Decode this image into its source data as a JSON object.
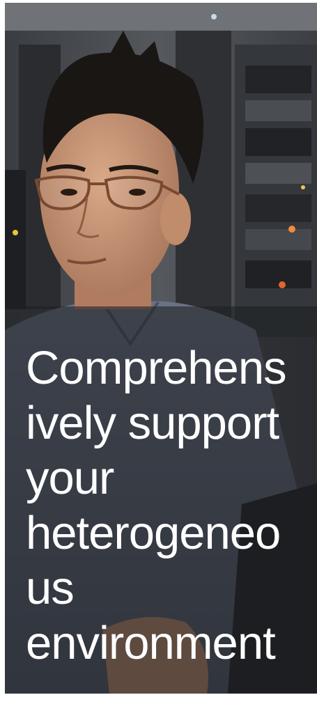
{
  "hero": {
    "image_icon": "person-with-server-racks-photo",
    "headline_lines": [
      "Comprehens",
      "ively support",
      "your",
      "heterogeneo",
      "us",
      "environment"
    ]
  },
  "colors": {
    "text": "#ffffff",
    "overlay": "#1e1f22",
    "shirt": "#5d6778",
    "server_light_orange": "#f28a3a"
  }
}
